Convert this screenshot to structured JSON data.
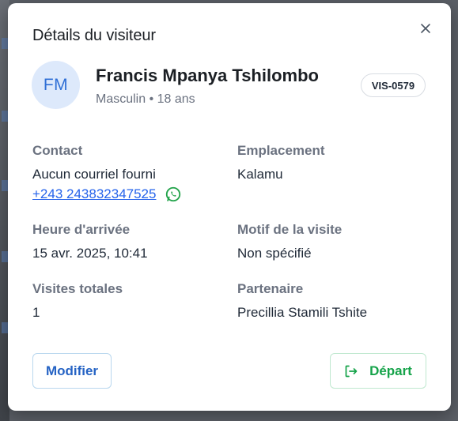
{
  "modal": {
    "title": "Détails du visiteur",
    "close_icon": "close-icon"
  },
  "visitor": {
    "initials": "FM",
    "name": "Francis Mpanya Tshilombo",
    "subline": "Masculin • 18 ans",
    "id_badge": "VIS-0579"
  },
  "fields": {
    "contact_label": "Contact",
    "email_value": "Aucun courriel fourni",
    "phone_value": "+243 243832347525",
    "phone_icon": "whatsapp-icon",
    "location_label": "Emplacement",
    "location_value": "Kalamu",
    "arrival_label": "Heure d'arrivée",
    "arrival_value": "15 avr. 2025, 10:41",
    "reason_label": "Motif de la visite",
    "reason_value": "Non spécifié",
    "total_visits_label": "Visites totales",
    "total_visits_value": "1",
    "partner_label": "Partenaire",
    "partner_value": "Precillia Stamili Tshite"
  },
  "actions": {
    "edit_label": "Modifier",
    "depart_label": "Départ",
    "depart_icon": "logout-arrow-icon"
  },
  "colors": {
    "accent_blue": "#2563c4",
    "accent_green": "#16a34a",
    "avatar_bg": "#dde9fb"
  }
}
